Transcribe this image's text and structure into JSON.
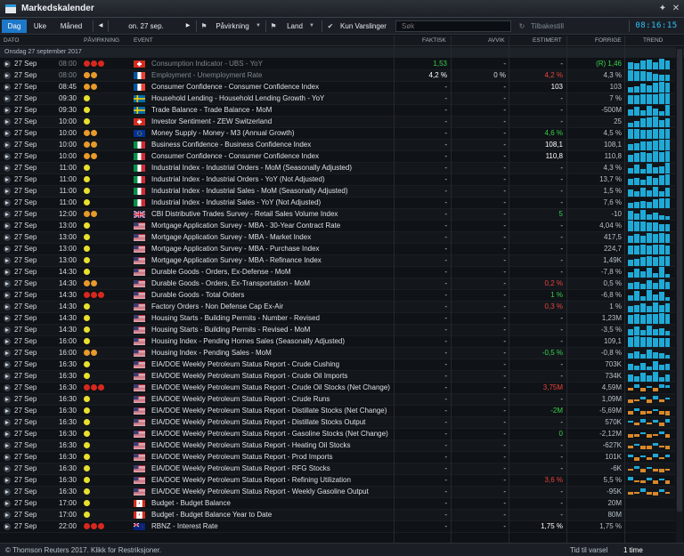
{
  "window": {
    "title": "Markedskalender",
    "clock": "08:16:15"
  },
  "toolbar": {
    "tab_day": "Dag",
    "tab_week": "Uke",
    "tab_month": "Måned",
    "prev": "◀",
    "date": "on. 27 sep.",
    "next": "▶",
    "impact": "Påvirkning",
    "country": "Land",
    "alerts": "Kun Varslinger",
    "search_placeholder": "Søk",
    "reset": "Tilbakestill"
  },
  "columns": {
    "date": "DATO",
    "impact": "PÅVIRKNING",
    "event": "EVENT",
    "actual": "FAKTISK",
    "deviation": "AVVIK",
    "estimate": "ESTIMERT",
    "previous": "FORRIGE",
    "trend": "TREND"
  },
  "group_label": "Onsdag 27 september 2017",
  "colors": {
    "accent": "#1e78c8",
    "positive": "#35d14a",
    "negative": "#e8423a",
    "impact_low": "#e8e02e",
    "impact_mid": "#e89a2a",
    "impact_high": "#d8281e",
    "trend_blue": "#1fa9d6",
    "trend_orange": "#d9892a"
  },
  "rows": [
    {
      "date": "27 Sep",
      "time": "08:00",
      "impact": "high",
      "flag": "ch",
      "event": "Consumption Indicator - UBS - YoY",
      "actual": "1,53",
      "actual_color": "green",
      "deviation": "-",
      "estimate": "-",
      "previous": "(R) 1,46",
      "prev_color": "green",
      "dim": true,
      "trend": [
        7,
        6,
        8,
        9,
        7,
        10,
        8
      ]
    },
    {
      "date": "27 Sep",
      "time": "08:00",
      "impact": "mid",
      "flag": "fr",
      "event": "Employment - Unemployment Rate",
      "actual": "4,2 %",
      "actual_color": "white",
      "deviation": "0 %",
      "estimate": "4,2 %",
      "estimate_color": "red",
      "previous": "4,3 %",
      "dim": true,
      "trend": [
        10,
        9,
        9,
        8,
        7,
        6,
        6
      ]
    },
    {
      "date": "27 Sep",
      "time": "08:45",
      "impact": "mid",
      "flag": "fr",
      "event": "Consumer Confidence - Consumer Confidence Index",
      "actual": "-",
      "deviation": "-",
      "estimate": "103",
      "estimate_color": "white",
      "previous": "103",
      "trend": [
        5,
        6,
        8,
        7,
        9,
        10,
        9
      ]
    },
    {
      "date": "27 Sep",
      "time": "09:30",
      "impact": "low",
      "flag": "se",
      "event": "Household Lending - Household Lending Growth - YoY",
      "actual": "-",
      "deviation": "-",
      "estimate": "-",
      "previous": "7 %",
      "trend": [
        8,
        8,
        9,
        9,
        9,
        10,
        10
      ]
    },
    {
      "date": "27 Sep",
      "time": "09:30",
      "impact": "low",
      "flag": "se",
      "event": "Trade Balance - Trade Balance - MoM",
      "actual": "-",
      "deviation": "-",
      "estimate": "-",
      "previous": "-500M",
      "trend": [
        6,
        8,
        5,
        9,
        7,
        4,
        10
      ]
    },
    {
      "date": "27 Sep",
      "time": "10:00",
      "impact": "low",
      "flag": "ch",
      "event": "Investor Sentiment - ZEW Switzerland",
      "actual": "-",
      "deviation": "-",
      "estimate": "-",
      "previous": "25",
      "trend": [
        4,
        6,
        8,
        9,
        10,
        7,
        8
      ]
    },
    {
      "date": "27 Sep",
      "time": "10:00",
      "impact": "mid",
      "flag": "eu",
      "event": "Money Supply - Money - M3 (Annual Growth)",
      "actual": "-",
      "deviation": "-",
      "estimate": "4,6 %",
      "estimate_color": "green",
      "previous": "4,5 %",
      "trend": [
        9,
        9,
        8,
        8,
        9,
        9,
        9
      ]
    },
    {
      "date": "27 Sep",
      "time": "10:00",
      "impact": "mid",
      "flag": "it",
      "event": "Business Confidence - Business Confidence Index",
      "actual": "-",
      "deviation": "-",
      "estimate": "108,1",
      "estimate_color": "white",
      "previous": "108,1",
      "trend": [
        6,
        7,
        8,
        8,
        9,
        10,
        10
      ]
    },
    {
      "date": "27 Sep",
      "time": "10:00",
      "impact": "mid",
      "flag": "it",
      "event": "Consumer Confidence - Consumer Confidence Index",
      "actual": "-",
      "deviation": "-",
      "estimate": "110,8",
      "estimate_color": "white",
      "previous": "110,8",
      "trend": [
        7,
        8,
        9,
        8,
        10,
        9,
        10
      ]
    },
    {
      "date": "27 Sep",
      "time": "11:00",
      "impact": "low",
      "flag": "it",
      "event": "Industrial Index - Industrial Orders - MoM (Seasonally Adjusted)",
      "actual": "-",
      "deviation": "-",
      "estimate": "-",
      "previous": "4,3 %",
      "trend": [
        5,
        8,
        4,
        9,
        6,
        7,
        10
      ]
    },
    {
      "date": "27 Sep",
      "time": "11:00",
      "impact": "low",
      "flag": "it",
      "event": "Industrial Index - Industrial Orders - YoY (Not Adjusted)",
      "actual": "-",
      "deviation": "-",
      "estimate": "-",
      "previous": "13,7 %",
      "trend": [
        6,
        7,
        5,
        8,
        7,
        9,
        10
      ]
    },
    {
      "date": "27 Sep",
      "time": "11:00",
      "impact": "low",
      "flag": "it",
      "event": "Industrial Index - Industrial Sales - MoM (Seasonally Adjusted)",
      "actual": "-",
      "deviation": "-",
      "estimate": "-",
      "previous": "1,5 %",
      "trend": [
        7,
        5,
        8,
        6,
        9,
        5,
        8
      ]
    },
    {
      "date": "27 Sep",
      "time": "11:00",
      "impact": "low",
      "flag": "it",
      "event": "Industrial Index - Industrial Sales - YoY (Not Adjusted)",
      "actual": "-",
      "deviation": "-",
      "estimate": "-",
      "previous": "7,6 %",
      "trend": [
        5,
        6,
        7,
        6,
        8,
        9,
        9
      ]
    },
    {
      "date": "27 Sep",
      "time": "12:00",
      "impact": "mid",
      "flag": "gb",
      "event": "CBI Distributive Trades Survey - Retail Sales Volume Index",
      "actual": "-",
      "deviation": "-",
      "estimate": "5",
      "estimate_color": "green",
      "previous": "-10",
      "trend": [
        8,
        6,
        9,
        5,
        7,
        4,
        3
      ]
    },
    {
      "date": "27 Sep",
      "time": "13:00",
      "impact": "low",
      "flag": "us",
      "event": "Mortgage Application Survey - MBA - 30-Year Contract Rate",
      "actual": "-",
      "deviation": "-",
      "estimate": "-",
      "previous": "4,04 %",
      "trend": [
        10,
        9,
        9,
        8,
        8,
        7,
        7
      ]
    },
    {
      "date": "27 Sep",
      "time": "13:00",
      "impact": "low",
      "flag": "us",
      "event": "Mortgage Application Survey - MBA - Market Index",
      "actual": "-",
      "deviation": "-",
      "estimate": "-",
      "previous": "417,5",
      "trend": [
        7,
        8,
        7,
        9,
        8,
        9,
        8
      ]
    },
    {
      "date": "27 Sep",
      "time": "13:00",
      "impact": "low",
      "flag": "us",
      "event": "Mortgage Application Survey - MBA - Purchase Index",
      "actual": "-",
      "deviation": "-",
      "estimate": "-",
      "previous": "224,7",
      "trend": [
        8,
        8,
        9,
        8,
        9,
        9,
        8
      ]
    },
    {
      "date": "27 Sep",
      "time": "13:00",
      "impact": "low",
      "flag": "us",
      "event": "Mortgage Application Survey - MBA - Refinance Index",
      "actual": "-",
      "deviation": "-",
      "estimate": "-",
      "previous": "1,49K",
      "trend": [
        6,
        7,
        8,
        9,
        8,
        9,
        9
      ]
    },
    {
      "date": "27 Sep",
      "time": "14:30",
      "impact": "low",
      "flag": "us",
      "event": "Durable Goods - Orders, Ex-Defense - MoM",
      "actual": "-",
      "deviation": "-",
      "estimate": "-",
      "previous": "-7,8 %",
      "trend": [
        5,
        8,
        6,
        9,
        4,
        10,
        3
      ]
    },
    {
      "date": "27 Sep",
      "time": "14:30",
      "impact": "mid",
      "flag": "us",
      "event": "Durable Goods - Orders, Ex-Transportation - MoM",
      "actual": "-",
      "deviation": "-",
      "estimate": "0,2 %",
      "estimate_color": "red",
      "previous": "0,5 %",
      "trend": [
        6,
        7,
        5,
        8,
        6,
        9,
        7
      ]
    },
    {
      "date": "27 Sep",
      "time": "14:30",
      "impact": "high",
      "flag": "us",
      "event": "Durable Goods - Total Orders",
      "actual": "-",
      "deviation": "-",
      "estimate": "1 %",
      "estimate_color": "green",
      "previous": "-6,8 %",
      "trend": [
        5,
        9,
        4,
        10,
        6,
        8,
        3
      ]
    },
    {
      "date": "27 Sep",
      "time": "14:30",
      "impact": "low",
      "flag": "us",
      "event": "Factory Orders - Non Defense Cap Ex-Air",
      "actual": "-",
      "deviation": "-",
      "estimate": "0,3 %",
      "estimate_color": "red",
      "previous": "1 %",
      "trend": [
        6,
        7,
        8,
        6,
        9,
        7,
        8
      ]
    },
    {
      "date": "27 Sep",
      "time": "14:30",
      "impact": "low",
      "flag": "us",
      "event": "Housing Starts - Building Permits - Number - Revised",
      "actual": "-",
      "deviation": "-",
      "estimate": "-",
      "previous": "1,23M",
      "trend": [
        8,
        9,
        8,
        9,
        9,
        10,
        9
      ]
    },
    {
      "date": "27 Sep",
      "time": "14:30",
      "impact": "low",
      "flag": "us",
      "event": "Housing Starts - Building Permits - Revised - MoM",
      "actual": "-",
      "deviation": "-",
      "estimate": "-",
      "previous": "-3,5 %",
      "trend": [
        6,
        8,
        5,
        9,
        6,
        7,
        4
      ]
    },
    {
      "date": "27 Sep",
      "time": "16:00",
      "impact": "low",
      "flag": "us",
      "event": "Housing Index - Pending Homes Sales (Seasonally Adjusted)",
      "actual": "-",
      "deviation": "-",
      "estimate": "-",
      "previous": "109,1",
      "trend": [
        9,
        10,
        9,
        9,
        8,
        8,
        8
      ]
    },
    {
      "date": "27 Sep",
      "time": "16:00",
      "impact": "mid",
      "flag": "us",
      "event": "Housing Index - Pending Sales - MoM",
      "actual": "-",
      "deviation": "-",
      "estimate": "-0,5 %",
      "estimate_color": "green",
      "previous": "-0,8 %",
      "trend": [
        5,
        7,
        4,
        8,
        6,
        5,
        3
      ]
    },
    {
      "date": "27 Sep",
      "time": "16:30",
      "impact": "low",
      "flag": "us",
      "event": "EIA/DOE Weekly Petroleum Status Report - Crude Cushing",
      "actual": "-",
      "deviation": "-",
      "estimate": "-",
      "previous": "703K",
      "trend": [
        6,
        4,
        7,
        3,
        8,
        5,
        6
      ]
    },
    {
      "date": "27 Sep",
      "time": "16:30",
      "impact": "low",
      "flag": "us",
      "event": "EIA/DOE Weekly Petroleum Status Report - Crude Oil Imports",
      "actual": "-",
      "deviation": "-",
      "estimate": "-",
      "previous": "734K",
      "trend": [
        7,
        5,
        8,
        6,
        9,
        4,
        7
      ]
    },
    {
      "date": "27 Sep",
      "time": "16:30",
      "impact": "high",
      "flag": "us",
      "event": "EIA/DOE Weekly Petroleum Status Report - Crude Oil Stocks (Net Change)",
      "actual": "-",
      "deviation": "-",
      "estimate": "3,75M",
      "estimate_color": "red",
      "previous": "4,59M",
      "trend": [
        -5,
        6,
        -7,
        4,
        -6,
        7,
        5
      ]
    },
    {
      "date": "27 Sep",
      "time": "16:30",
      "impact": "low",
      "flag": "us",
      "event": "EIA/DOE Weekly Petroleum Status Report - Crude Runs",
      "actual": "-",
      "deviation": "-",
      "estimate": "-",
      "previous": "1,09M",
      "trend": [
        -6,
        -4,
        5,
        -7,
        6,
        -5,
        4
      ]
    },
    {
      "date": "27 Sep",
      "time": "16:30",
      "impact": "low",
      "flag": "us",
      "event": "EIA/DOE Weekly Petroleum Status Report - Distillate Stocks (Net Change)",
      "actual": "-",
      "deviation": "-",
      "estimate": "-2M",
      "estimate_color": "green",
      "previous": "-5,69M",
      "trend": [
        -7,
        5,
        -6,
        -5,
        4,
        -6,
        -8
      ]
    },
    {
      "date": "27 Sep",
      "time": "16:30",
      "impact": "low",
      "flag": "us",
      "event": "EIA/DOE Weekly Petroleum Status Report - Distillate Stocks Output",
      "actual": "-",
      "deviation": "-",
      "estimate": "-",
      "previous": "570K",
      "trend": [
        4,
        -5,
        6,
        -4,
        5,
        -6,
        7
      ]
    },
    {
      "date": "27 Sep",
      "time": "16:30",
      "impact": "low",
      "flag": "us",
      "event": "EIA/DOE Weekly Petroleum Status Report - Gasoline Stocks (Net Change)",
      "actual": "-",
      "deviation": "-",
      "estimate": "0",
      "estimate_color": "green",
      "previous": "-2,12M",
      "trend": [
        -6,
        -5,
        4,
        -7,
        -4,
        5,
        -6
      ]
    },
    {
      "date": "27 Sep",
      "time": "16:30",
      "impact": "low",
      "flag": "us",
      "event": "EIA/DOE Weekly Petroleum Status Report - Heating Oil Stocks",
      "actual": "-",
      "deviation": "-",
      "estimate": "-",
      "previous": "-627K",
      "trend": [
        -5,
        4,
        -6,
        -7,
        5,
        -4,
        -6
      ]
    },
    {
      "date": "27 Sep",
      "time": "16:30",
      "impact": "low",
      "flag": "us",
      "event": "EIA/DOE Weekly Petroleum Status Report - Prod Imports",
      "actual": "-",
      "deviation": "-",
      "estimate": "-",
      "previous": "101K",
      "trend": [
        5,
        -6,
        4,
        -5,
        6,
        -4,
        5
      ]
    },
    {
      "date": "27 Sep",
      "time": "16:30",
      "impact": "low",
      "flag": "us",
      "event": "EIA/DOE Weekly Petroleum Status Report - RFG Stocks",
      "actual": "-",
      "deviation": "-",
      "estimate": "-",
      "previous": "-6K",
      "trend": [
        -4,
        5,
        -6,
        4,
        -5,
        -6,
        -4
      ]
    },
    {
      "date": "27 Sep",
      "time": "16:30",
      "impact": "low",
      "flag": "us",
      "event": "EIA/DOE Weekly Petroleum Status Report - Refining Utilization",
      "actual": "-",
      "deviation": "-",
      "estimate": "3,6 %",
      "estimate_color": "red",
      "previous": "5,5 %",
      "trend": [
        6,
        -4,
        -5,
        5,
        -6,
        4,
        -7
      ]
    },
    {
      "date": "27 Sep",
      "time": "16:30",
      "impact": "low",
      "flag": "us",
      "event": "EIA/DOE Weekly Petroleum Status Report - Weekly Gasoline Output",
      "actual": "-",
      "deviation": "-",
      "estimate": "-",
      "previous": "-95K",
      "trend": [
        -5,
        -4,
        6,
        -5,
        -6,
        5,
        -4
      ]
    },
    {
      "date": "27 Sep",
      "time": "17:00",
      "impact": "low",
      "flag": "ca",
      "event": "Budget - Budget Balance",
      "actual": "-",
      "deviation": "-",
      "estimate": "-",
      "previous": "20M",
      "trend": []
    },
    {
      "date": "27 Sep",
      "time": "17:00",
      "impact": "low",
      "flag": "ca",
      "event": "Budget - Budget Balance Year to Date",
      "actual": "-",
      "deviation": "-",
      "estimate": "-",
      "previous": "80M",
      "trend": []
    },
    {
      "date": "27 Sep",
      "time": "22:00",
      "impact": "high",
      "flag": "nz",
      "event": "RBNZ - Interest Rate",
      "actual": "-",
      "deviation": "-",
      "estimate": "1,75 %",
      "estimate_color": "white",
      "previous": "1,75 %",
      "trend": []
    }
  ],
  "status": {
    "copyright": "© Thomson Reuters 2017. Klikk for Restriksjoner.",
    "show_alert": "Tid til varsel",
    "interval": "1 time"
  }
}
